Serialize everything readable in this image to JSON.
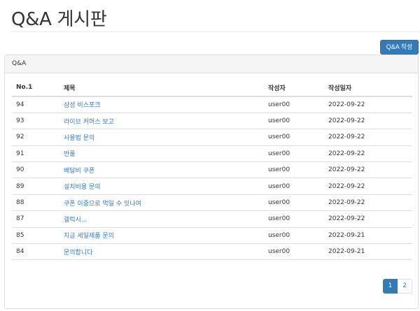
{
  "header": {
    "title": "Q&A 게시판"
  },
  "toolbar": {
    "write_label": "Q&A 작성"
  },
  "panel": {
    "heading": "Q&A"
  },
  "table": {
    "columns": {
      "no": "No.1",
      "title": "제목",
      "writer": "작성자",
      "date": "작성일자"
    },
    "rows": [
      {
        "no": "94",
        "title": "삼성 비스포크",
        "writer": "user00",
        "date": "2022-09-22"
      },
      {
        "no": "93",
        "title": "라이브 커머스 보고",
        "writer": "user00",
        "date": "2022-09-22"
      },
      {
        "no": "92",
        "title": "사용법 문의",
        "writer": "user00",
        "date": "2022-09-22"
      },
      {
        "no": "91",
        "title": "반품",
        "writer": "user00",
        "date": "2022-09-22"
      },
      {
        "no": "90",
        "title": "배달비 쿠폰",
        "writer": "user00",
        "date": "2022-09-22"
      },
      {
        "no": "89",
        "title": "설치비용 문의",
        "writer": "user00",
        "date": "2022-09-22"
      },
      {
        "no": "88",
        "title": "쿠폰 이중으로 먹일 수 잇나여",
        "writer": "user00",
        "date": "2022-09-22"
      },
      {
        "no": "87",
        "title": "갤럭시...",
        "writer": "user00",
        "date": "2022-09-22"
      },
      {
        "no": "85",
        "title": "지금 세일제품 문의",
        "writer": "user00",
        "date": "2022-09-21"
      },
      {
        "no": "84",
        "title": "문의합니다",
        "writer": "user00",
        "date": "2022-09-21"
      }
    ]
  },
  "pagination": {
    "pages": [
      "1",
      "2"
    ],
    "current": "1"
  },
  "colors": {
    "primary": "#337ab7",
    "border": "#dddddd",
    "heading_bg": "#f5f5f5"
  }
}
